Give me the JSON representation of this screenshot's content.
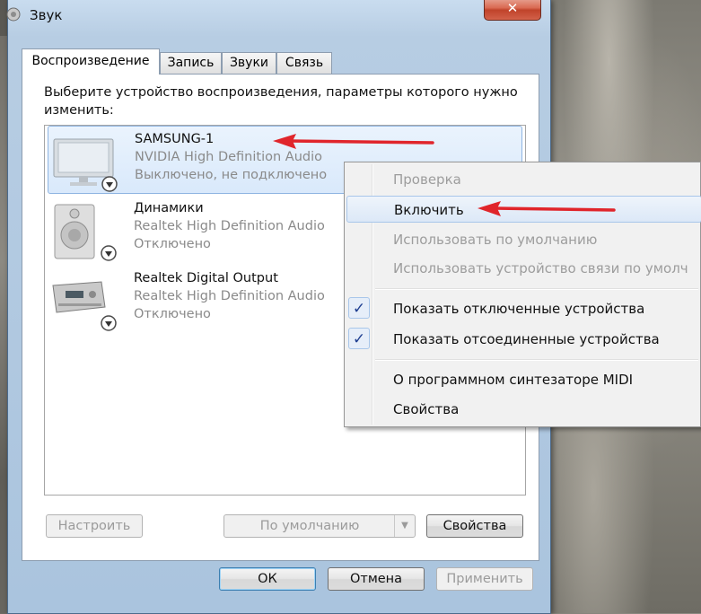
{
  "window": {
    "title": "Звук",
    "close_symbol": "✕"
  },
  "tabs": [
    {
      "label": "Воспроизведение",
      "active": true
    },
    {
      "label": "Запись",
      "active": false
    },
    {
      "label": "Звуки",
      "active": false
    },
    {
      "label": "Связь",
      "active": false
    }
  ],
  "panel": {
    "instruction": "Выберите устройство воспроизведения, параметры которого нужно изменить:"
  },
  "devices": [
    {
      "name": "SAMSUNG-1",
      "driver": "NVIDIA High Definition Audio",
      "status": "Выключено, не подключено",
      "icon": "monitor-icon",
      "selected": true
    },
    {
      "name": "Динамики",
      "driver": "Realtek High Definition Audio",
      "status": "Отключено",
      "icon": "speaker-icon",
      "selected": false
    },
    {
      "name": "Realtek Digital Output",
      "driver": "Realtek High Definition Audio",
      "status": "Отключено",
      "icon": "receiver-icon",
      "selected": false
    }
  ],
  "panel_buttons": {
    "configure": "Настроить",
    "default": "По умолчанию",
    "properties": "Свойства"
  },
  "dialog_buttons": {
    "ok": "ОК",
    "cancel": "Отмена",
    "apply": "Применить"
  },
  "context_menu": {
    "items": [
      {
        "label": "Проверка",
        "enabled": false,
        "checked": false
      },
      {
        "label": "Включить",
        "enabled": true,
        "checked": false,
        "highlighted": true
      },
      {
        "label": "Использовать по умолчанию",
        "enabled": false,
        "checked": false
      },
      {
        "label": "Использовать устройство связи по умолч",
        "enabled": false,
        "checked": false
      },
      {
        "label": "Показать отключенные устройства",
        "enabled": true,
        "checked": true
      },
      {
        "label": "Показать отсоединенные устройства",
        "enabled": true,
        "checked": true
      },
      {
        "label": "О программном синтезаторе MIDI",
        "enabled": true,
        "checked": false
      },
      {
        "label": "Свойства",
        "enabled": true,
        "checked": false
      }
    ],
    "check_symbol": "✓"
  },
  "colors": {
    "annotation_arrow": "#e0252b",
    "selection_border": "#8fb5e2",
    "close_button": "#c0432a"
  }
}
